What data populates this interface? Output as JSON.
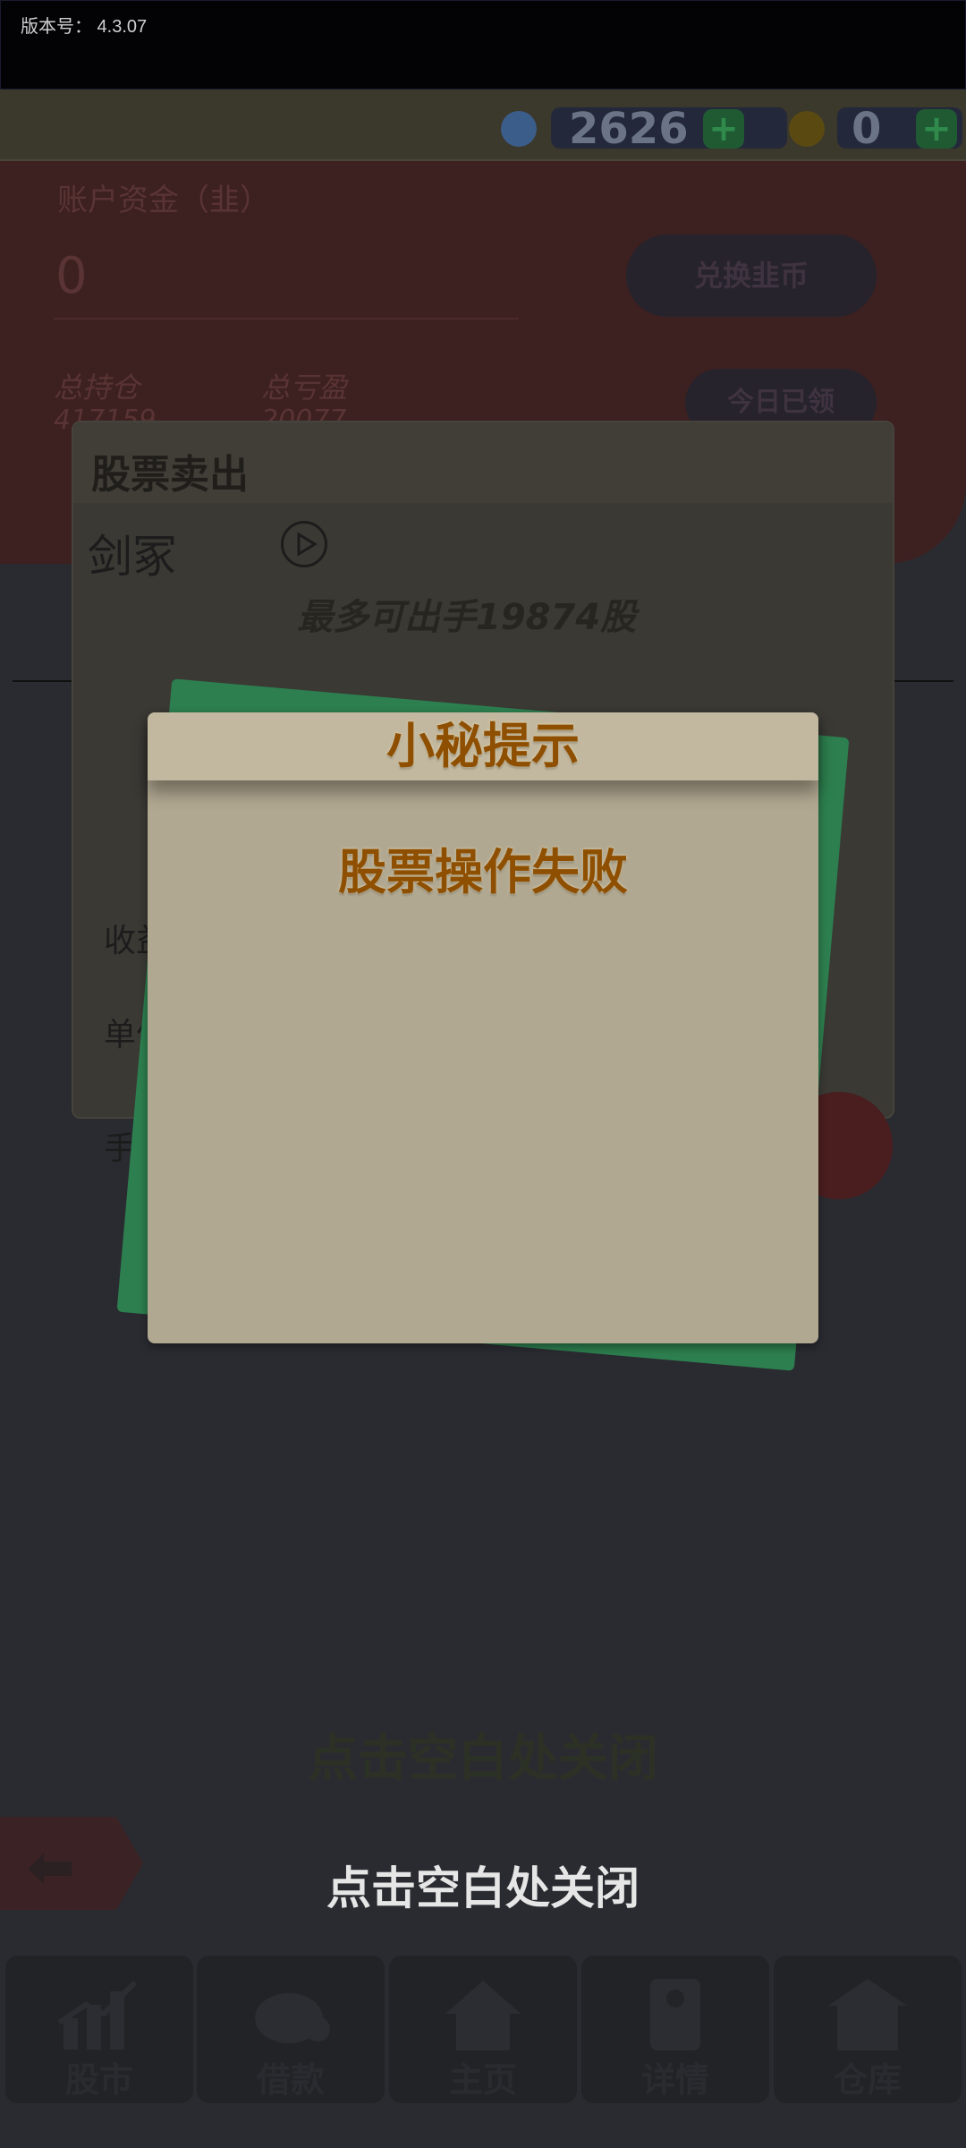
{
  "status_bar": {
    "version_text": "版本号：  4.3.07"
  },
  "currency": {
    "gems_value": "2626",
    "coins_value": "0",
    "plus_symbol": "+",
    "gem_color": "#3b5d8a",
    "coin_color": "#5a4a12"
  },
  "account": {
    "funds_label": "账户资金（韭）",
    "funds_value": "0",
    "exchange_button": "兑换韭币",
    "today_button": "今日已领",
    "total_position_label": "总持仓",
    "total_position_value": "417159",
    "total_pnl_label": "总亏盈",
    "total_pnl_value": "20077"
  },
  "sell_panel": {
    "title": "股票卖出",
    "stock_name": "剑冢",
    "sellable_text": "最多可出手19874股",
    "row_labels": [
      "收益",
      "单价",
      "手续"
    ]
  },
  "modal": {
    "title": "小秘提示",
    "message": "股票操作失败"
  },
  "hint_behind": "点击空白处关闭",
  "close_hint": "点击空白处关闭",
  "back_button": {
    "icon": "arrow-left-icon"
  },
  "bottom_nav": [
    {
      "label": "股市",
      "icon": "chart-icon"
    },
    {
      "label": "借款",
      "icon": "piggy-bank-icon"
    },
    {
      "label": "主页",
      "icon": "home-icon"
    },
    {
      "label": "详情",
      "icon": "document-icon"
    },
    {
      "label": "仓库",
      "icon": "warehouse-icon"
    }
  ],
  "colors": {
    "modal_bg": "#b1a891",
    "modal_title": "#8f4f00",
    "green_card": "#2d7f4f"
  }
}
